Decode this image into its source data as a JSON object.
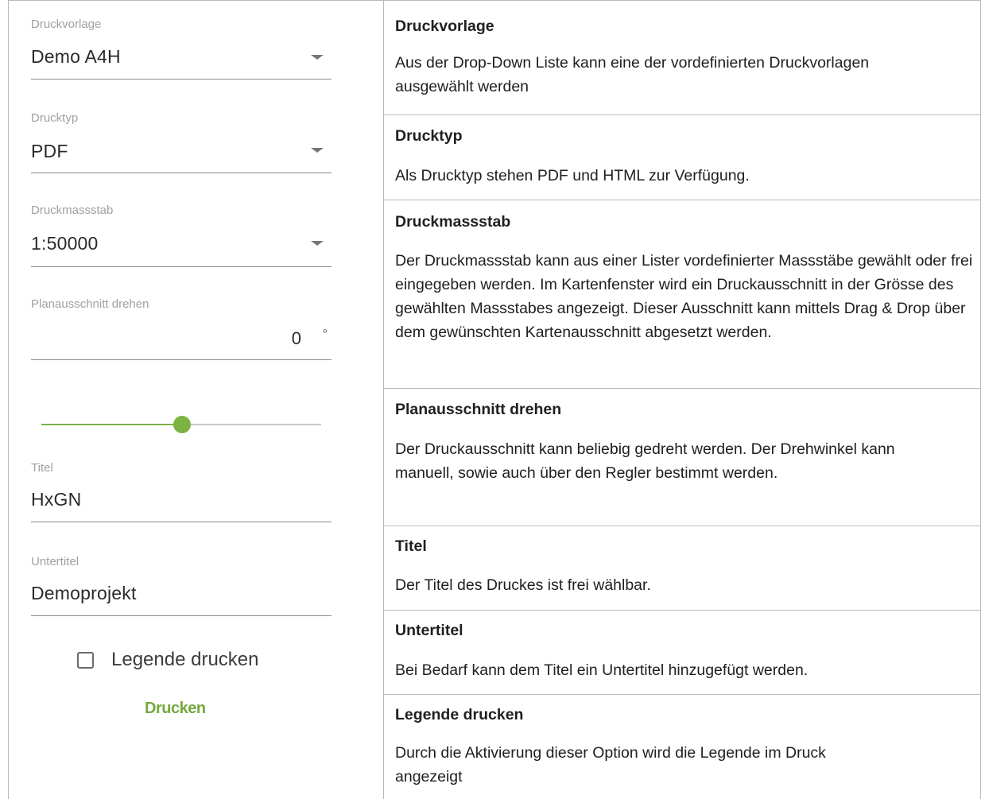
{
  "form": {
    "druckvorlage": {
      "label": "Druckvorlage",
      "value": "Demo A4H"
    },
    "drucktyp": {
      "label": "Drucktyp",
      "value": "PDF"
    },
    "druckmassstab": {
      "label": "Druckmassstab",
      "value": "1:50000"
    },
    "rotation": {
      "label": "Planausschnitt drehen",
      "value": "0",
      "unit": "°"
    },
    "rotation_slider": {
      "level": 0.5
    },
    "titel": {
      "label": "Titel",
      "value": "HxGN"
    },
    "untertitel": {
      "label": "Untertitel",
      "value": "Demoprojekt"
    },
    "legend_checkbox": {
      "label": "Legende drucken",
      "checked": false
    },
    "print_button": {
      "label": "Drucken"
    }
  },
  "descriptions": [
    {
      "title": "Druckvorlage",
      "text": "Aus der Drop-Down Liste kann eine der vordefinierten Druckvorlagen ausgewählt werden"
    },
    {
      "title": "Drucktyp",
      "text": "Als Drucktyp stehen PDF und HTML zur Verfügung."
    },
    {
      "title": "Druckmassstab",
      "text": "Der Druckmassstab kann aus einer Lister vordefinierter Massstäbe gewählt oder frei eingegeben werden. Im Kartenfenster wird ein Druckausschnitt in der Grösse des gewählten Massstabes angezeigt. Dieser Ausschnitt kann mittels Drag & Drop über dem gewünschten Kartenausschnitt abgesetzt werden."
    },
    {
      "title": "Planausschnitt drehen",
      "text": "Der Druckausschnitt kann beliebig gedreht werden. Der Drehwinkel kann manuell, sowie auch über den Regler bestimmt werden."
    },
    {
      "title": "Titel",
      "text": "Der Titel des Druckes ist frei wählbar."
    },
    {
      "title": "Untertitel",
      "text": "Bei Bedarf kann dem Titel ein Untertitel hinzugefügt werden."
    },
    {
      "title": "Legende drucken",
      "text": "Durch die Aktivierung dieser Option wird die Legende im Druck angezeigt"
    }
  ],
  "colors": {
    "accent": "#7cb342",
    "track": "#c8c8c8",
    "border": "#b9b9b9"
  }
}
